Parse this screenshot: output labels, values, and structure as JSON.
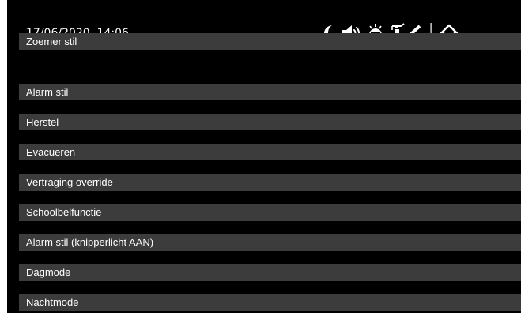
{
  "header": {
    "datetime": "17/06/2020  14:06",
    "icons": [
      "moon-icon",
      "speaker-icon",
      "fire-bell-icon",
      "fire-extinguisher-icon",
      "back-icon",
      "home-icon"
    ]
  },
  "menu": {
    "items": [
      {
        "label": "Zoemer stil"
      },
      {
        "label": "Alarm stil"
      },
      {
        "label": "Herstel"
      },
      {
        "label": "Evacueren"
      },
      {
        "label": "Vertraging override"
      },
      {
        "label": "Schoolbelfunctie"
      },
      {
        "label": "Alarm stil (knipperlicht AAN)"
      },
      {
        "label": "Dagmode"
      },
      {
        "label": "Nachtmode"
      }
    ]
  },
  "colors": {
    "background": "#000000",
    "menu_item": "#3c3c3c",
    "text": "#ffffff"
  }
}
